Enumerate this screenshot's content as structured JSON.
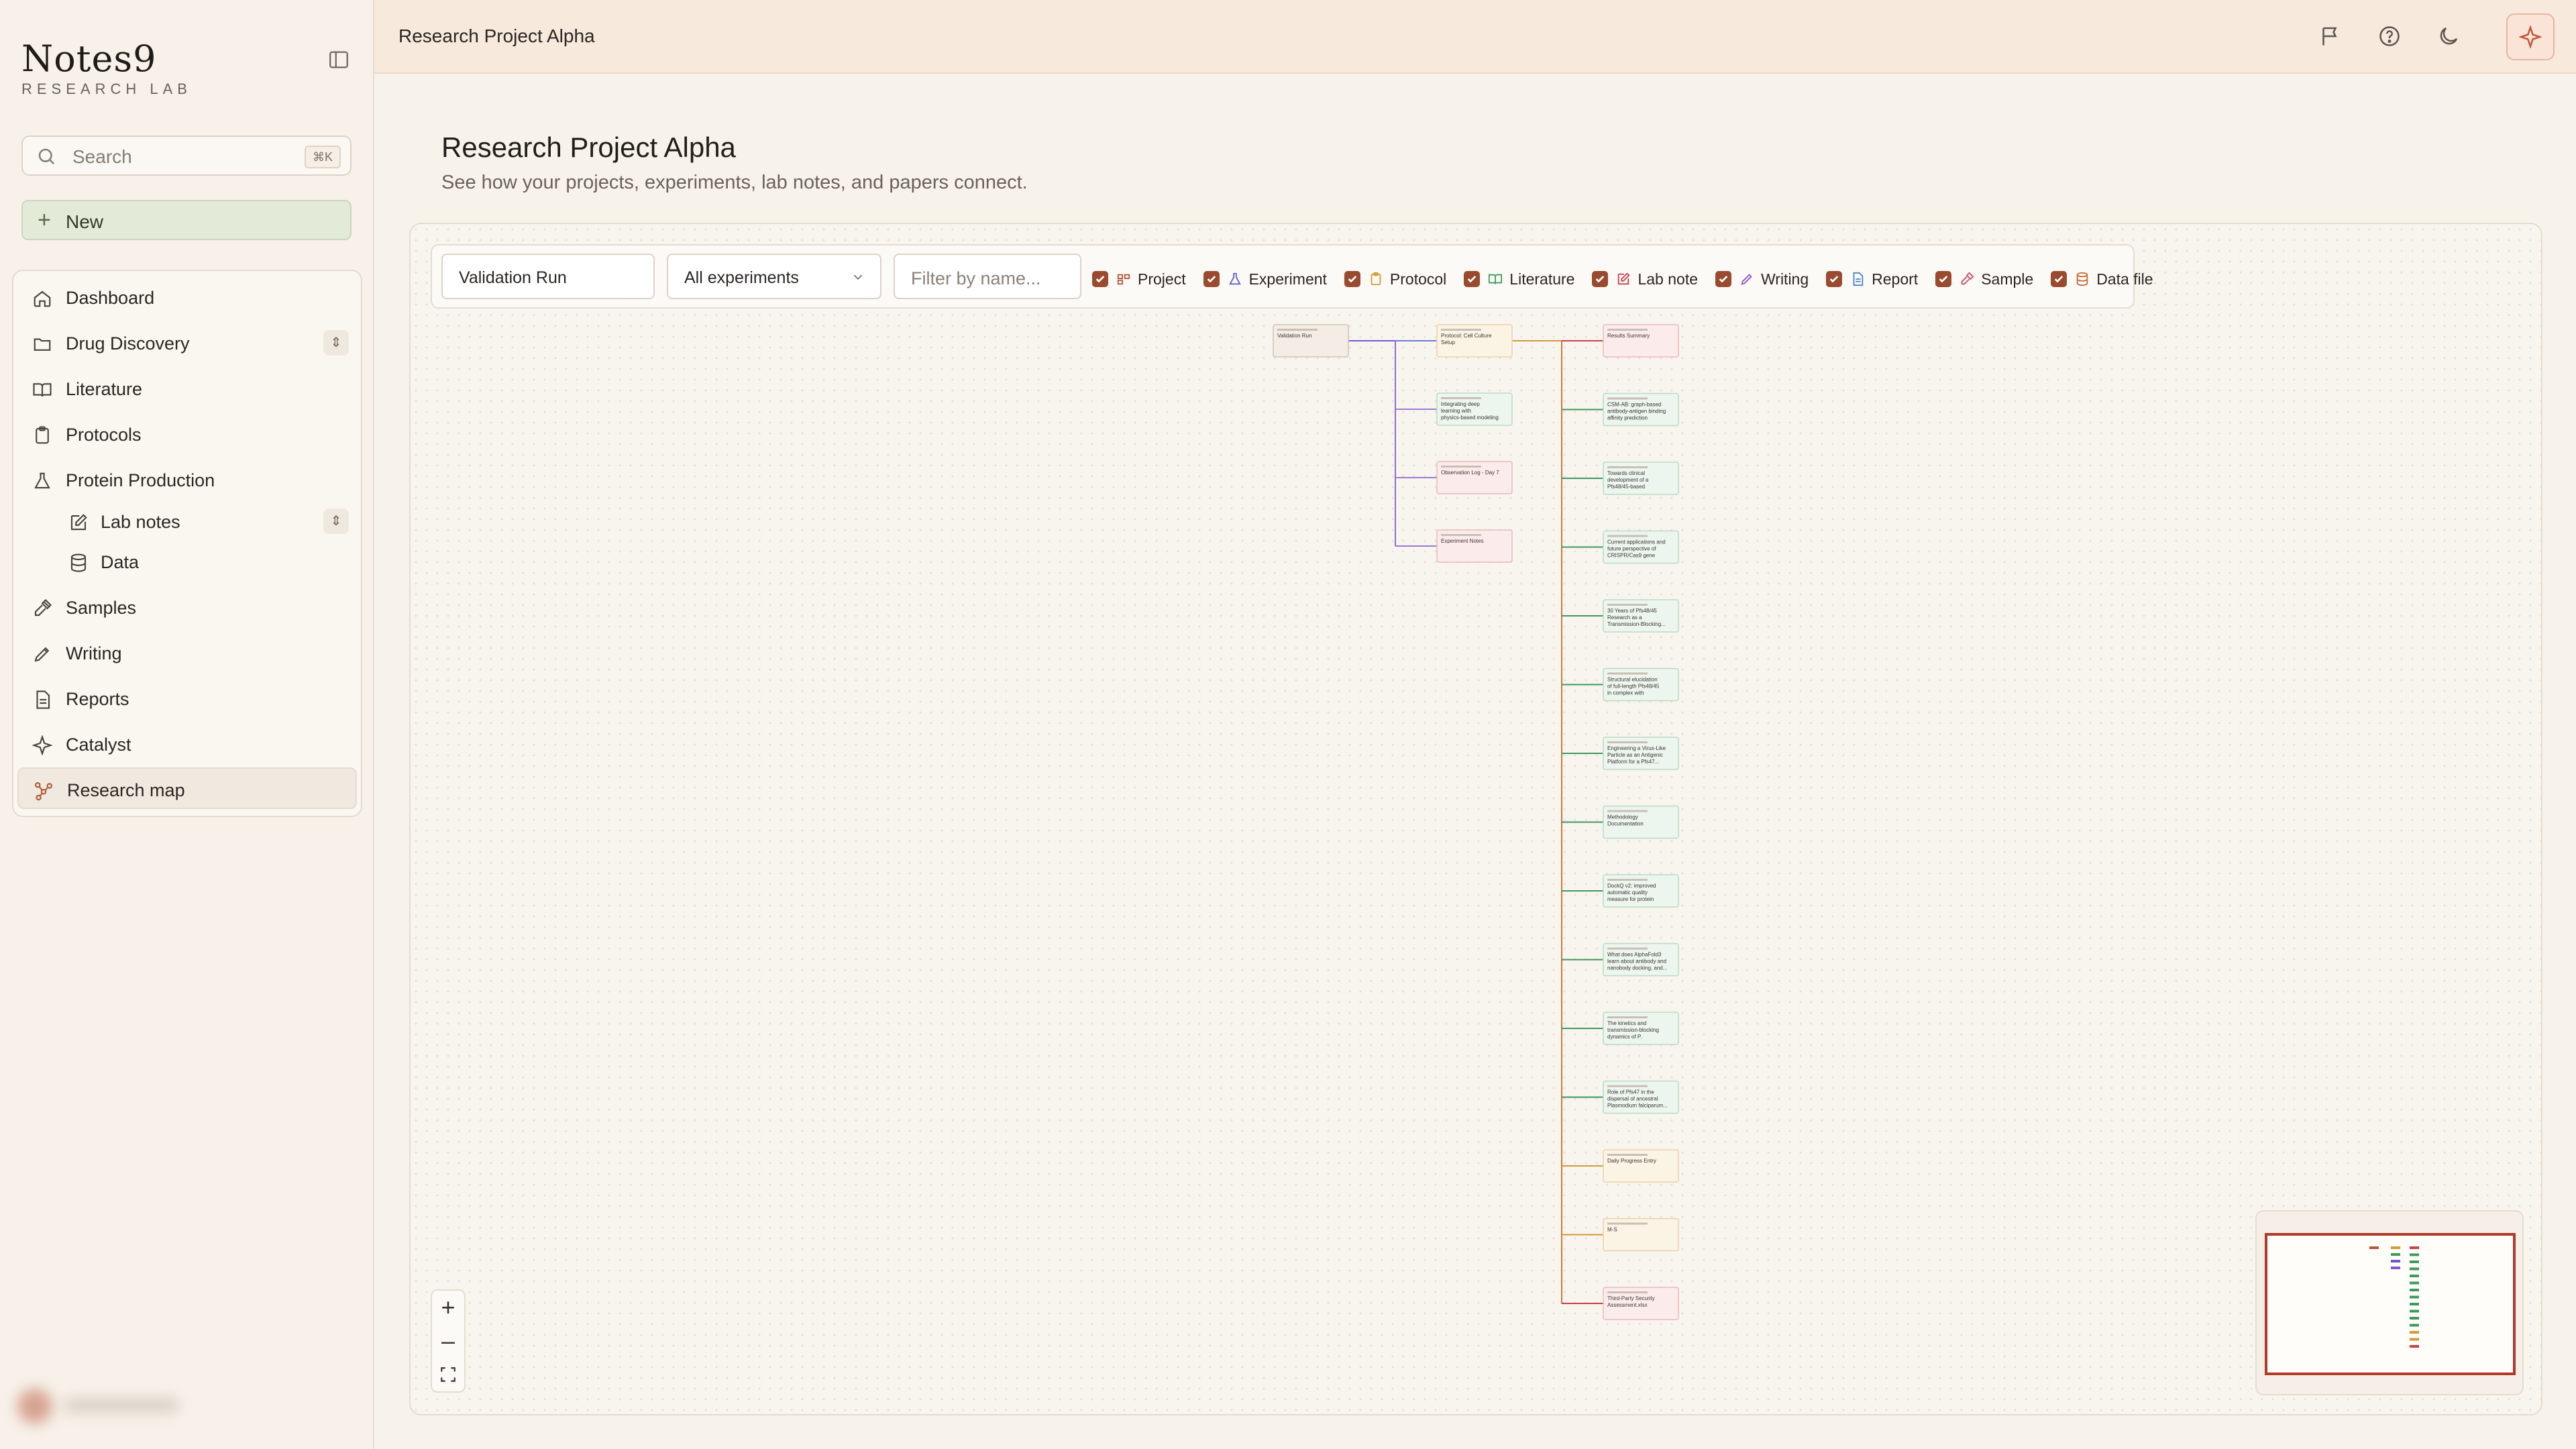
{
  "app": {
    "brand": "Notes9",
    "brand_sub": "RESEARCH LAB"
  },
  "sidebar": {
    "search_placeholder": "Search",
    "search_shortcut": "⌘K",
    "new_label": "New",
    "items": [
      {
        "label": "Dashboard",
        "icon": "home-icon"
      },
      {
        "label": "Drug Discovery",
        "icon": "folder-icon",
        "expandable": true
      },
      {
        "label": "Literature",
        "icon": "book-icon"
      },
      {
        "label": "Protocols",
        "icon": "clipboard-icon"
      },
      {
        "label": "Protein Production",
        "icon": "flask-icon"
      },
      {
        "label": "Lab notes",
        "icon": "edit-icon",
        "sub": true,
        "expandable": true
      },
      {
        "label": "Data",
        "icon": "database-icon",
        "sub": true
      },
      {
        "label": "Samples",
        "icon": "pipette-icon"
      },
      {
        "label": "Writing",
        "icon": "pen-icon"
      },
      {
        "label": "Reports",
        "icon": "file-icon"
      },
      {
        "label": "Catalyst",
        "icon": "sparkle-icon"
      },
      {
        "label": "Research map",
        "icon": "network-icon",
        "active": true
      }
    ]
  },
  "topbar": {
    "breadcrumb": "Research Project Alpha"
  },
  "page": {
    "title": "Research Project Alpha",
    "subtitle": "See how your projects, experiments, lab notes, and papers connect."
  },
  "filters": {
    "selected_item": "Validation Run",
    "experiment_select": "All experiments",
    "name_placeholder": "Filter by name...",
    "types": [
      {
        "label": "Project",
        "checked": true,
        "color": "#b5573a"
      },
      {
        "label": "Experiment",
        "checked": true,
        "color": "#5b62c9"
      },
      {
        "label": "Protocol",
        "checked": true,
        "color": "#d39a3a"
      },
      {
        "label": "Literature",
        "checked": true,
        "color": "#3e9a5c"
      },
      {
        "label": "Lab note",
        "checked": true,
        "color": "#c9404a"
      },
      {
        "label": "Writing",
        "checked": true,
        "color": "#8f55c9"
      },
      {
        "label": "Report",
        "checked": true,
        "color": "#4a86c9"
      },
      {
        "label": "Sample",
        "checked": true,
        "color": "#c9506a"
      },
      {
        "label": "Data file",
        "checked": true,
        "color": "#c96a3a"
      }
    ]
  },
  "graph": {
    "colors": {
      "project": "#b5573a",
      "experiment": "#6d5bd0",
      "literature": "#3e9a5c",
      "protocol": "#d39a3a",
      "labnote": "#c9404a"
    },
    "root": {
      "label": "Validation Run"
    },
    "column2": [
      {
        "label": "Protocol: Cell Culture Setup",
        "kind": "protocol"
      },
      {
        "label": "Integrating deep learning with physics-based modeling enables high...",
        "kind": "literature"
      },
      {
        "label": "Observation Log - Day 7",
        "kind": "labnote"
      },
      {
        "label": "Experiment Notes",
        "kind": "labnote"
      }
    ],
    "column3": [
      {
        "label": "Results Summary",
        "kind": "labnote"
      },
      {
        "label": "CSM-AB: graph-based antibody-antigen binding affinity prediction and...",
        "kind": "literature"
      },
      {
        "label": "Towards clinical development of a Pfs48/45-based transmission-blocki...",
        "kind": "literature"
      },
      {
        "label": "Current applications and future perspective of CRISPR/Cas9 gene editing...",
        "kind": "literature"
      },
      {
        "label": "30 Years of Pfs48/45 Research as a Transmission-Blocking...",
        "kind": "literature"
      },
      {
        "label": "Structural elucidation of full-length Pfs48/45 in complex with potent...",
        "kind": "literature"
      },
      {
        "label": "Engineering a Virus-Like Particle as an Antigenic Platform for a Pfs47...",
        "kind": "literature"
      },
      {
        "label": "Methodology Documentation",
        "kind": "literature"
      },
      {
        "label": "DockQ v2: improved automatic quality measure for protein multimers,...",
        "kind": "literature"
      },
      {
        "label": "What does AlphaFold3 learn about antibody and nanobody docking, and...",
        "kind": "literature"
      },
      {
        "label": "The kinetics and transmission-blocking dynamics of P. falciparum...",
        "kind": "literature"
      },
      {
        "label": "Role of Pfs47 in the dispersal of ancestral Plasmodium falciparum...",
        "kind": "literature"
      },
      {
        "label": "Daily Progress Entry",
        "kind": "protocol"
      },
      {
        "label": "M-S",
        "kind": "protocol"
      },
      {
        "label": "Third-Party Security Assessment.xlsx",
        "kind": "labnote"
      }
    ]
  }
}
